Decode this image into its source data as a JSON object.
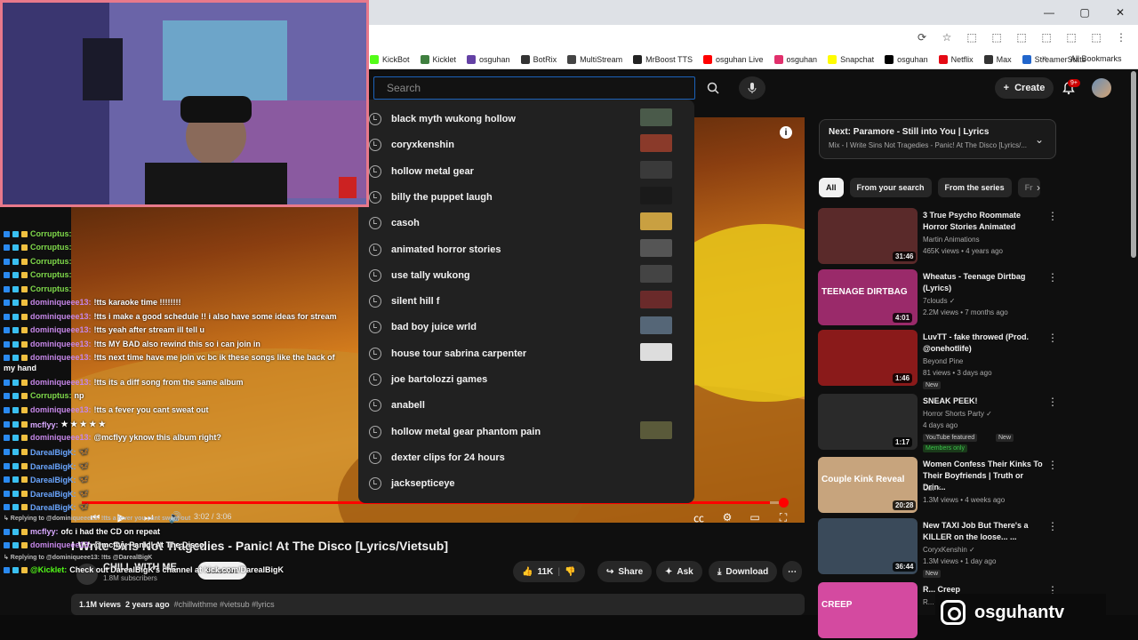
{
  "browser": {
    "controls": [
      "—",
      "▢",
      "✕"
    ],
    "addr_icons": [
      "⟳",
      "☆",
      "⬚",
      "⬚",
      "⬚",
      "⬚",
      "⬚",
      "⬚",
      "⋮"
    ]
  },
  "bookmarks": [
    {
      "label": "KickBot",
      "color": "#53fc18"
    },
    {
      "label": "Kicklet",
      "color": "#3f7f3f"
    },
    {
      "label": "osguhan",
      "color": "#6441a5"
    },
    {
      "label": "BotRix",
      "color": "#333333"
    },
    {
      "label": "MultiStream",
      "color": "#444444"
    },
    {
      "label": "MrBoost TTS",
      "color": "#222222"
    },
    {
      "label": "osguhan Live",
      "color": "#ff0000"
    },
    {
      "label": "osguhan",
      "color": "#e1306c"
    },
    {
      "label": "Snapchat",
      "color": "#fffc00"
    },
    {
      "label": "osguhan",
      "color": "#000000"
    },
    {
      "label": "Netflix",
      "color": "#e50914"
    },
    {
      "label": "Max",
      "color": "#333333"
    },
    {
      "label": "StreamerStats",
      "color": "#2266cc"
    }
  ],
  "bookmarks_more": "»",
  "all_bookmarks": "All Bookmarks",
  "search": {
    "placeholder": "Search"
  },
  "header": {
    "create_label": "Create",
    "notif_count": "9+"
  },
  "suggestions": [
    {
      "text": "black myth wukong hollow",
      "thumb": "#4a5a4a"
    },
    {
      "text": "coryxkenshin",
      "thumb": "#8a3a2a"
    },
    {
      "text": "hollow metal gear",
      "thumb": "#3a3a3a"
    },
    {
      "text": "billy the puppet laugh",
      "thumb": "#1a1a1a"
    },
    {
      "text": "casoh",
      "thumb": "#c9a041"
    },
    {
      "text": "animated horror stories",
      "thumb": "#555555"
    },
    {
      "text": "use tally wukong",
      "thumb": "#444444"
    },
    {
      "text": "silent hill f",
      "thumb": "#6a2a2a"
    },
    {
      "text": "bad boy juice wrld",
      "thumb": "#556677"
    },
    {
      "text": "house tour sabrina carpenter",
      "thumb": "#dddddd"
    },
    {
      "text": "joe bartolozzi games",
      "thumb": ""
    },
    {
      "text": "anabell",
      "thumb": ""
    },
    {
      "text": "hollow metal gear phantom pain",
      "thumb": "#5a5a3a"
    },
    {
      "text": "dexter clips for 24 hours",
      "thumb": ""
    },
    {
      "text": "jacksepticeye",
      "thumb": ""
    }
  ],
  "player": {
    "time": "3:02 / 3:06",
    "progress": 0.98
  },
  "video": {
    "title": "I Write Sins Not Tragedies - Panic! At The Disco [Lyrics/Vietsub]",
    "channel": "CHILL WITH ME",
    "subs": "1.8M subscribers",
    "subscribe": "Subscribe",
    "likes": "11K",
    "share": "Share",
    "ask": "Ask",
    "download": "Download",
    "views": "1.1M views",
    "age": "2 years ago",
    "tags": "#chillwithme #vietsub #lyrics"
  },
  "chat": [
    {
      "name": "Corruptus:",
      "color": "#7fd94a",
      "msg": ""
    },
    {
      "name": "Corruptus:",
      "color": "#7fd94a",
      "msg": ""
    },
    {
      "name": "Corruptus:",
      "color": "#7fd94a",
      "msg": ""
    },
    {
      "name": "Corruptus:",
      "color": "#7fd94a",
      "msg": ""
    },
    {
      "name": "Corruptus:",
      "color": "#7fd94a",
      "msg": ""
    },
    {
      "name": "dominiqueee13:",
      "color": "#c586e8",
      "msg": "!tts karaoke time !!!!!!!!"
    },
    {
      "name": "dominiqueee13:",
      "color": "#c586e8",
      "msg": "!tts i make a good schedule !! i also have some ideas for stream"
    },
    {
      "name": "dominiqueee13:",
      "color": "#c586e8",
      "msg": "!tts yeah after stream ill tell u"
    },
    {
      "name": "dominiqueee13:",
      "color": "#c586e8",
      "msg": "!tts MY BAD also rewind this so i can join in"
    },
    {
      "name": "dominiqueee13:",
      "color": "#c586e8",
      "msg": "!tts next time have me join vc bc ik these songs like the back of"
    },
    {
      "name": "dominiqueee13:",
      "color": "#c586e8",
      "msg": "!tts its a diff song from the same album"
    },
    {
      "name": "Corruptus:",
      "color": "#7fd94a",
      "msg": "np"
    },
    {
      "name": "dominiqueee13:",
      "color": "#c586e8",
      "msg": "!tts a fever you cant sweat out"
    },
    {
      "name": "mcflyy:",
      "color": "#d8a8ff",
      "msg": "★ ★ ★ ★ ★"
    },
    {
      "name": "dominiqueee13:",
      "color": "#c586e8",
      "msg": "@mcflyy yknow this album right?"
    },
    {
      "name": "DarealBigK:",
      "color": "#6aa6ff",
      "msg": "🦋"
    },
    {
      "name": "DarealBigK:",
      "color": "#6aa6ff",
      "msg": "🦋"
    },
    {
      "name": "DarealBigK:",
      "color": "#6aa6ff",
      "msg": "🦋"
    },
    {
      "name": "DarealBigK:",
      "color": "#6aa6ff",
      "msg": "🦋"
    },
    {
      "name": "DarealBigK:",
      "color": "#6aa6ff",
      "msg": "🦋"
    }
  ],
  "chat_wrap": "my hand",
  "chat_reply1": "↳ Replying to @dominiqueee13: !tts a fever you cant sweat out",
  "chat_line_a": {
    "name": "mcflyy:",
    "color": "#d8a8ff",
    "msg": "ofc i had the CD on repeat"
  },
  "chat_line_b": {
    "name": "dominiqueee13:",
    "color": "#c586e8",
    "msg": "@mcflyy Panic! At The Disco"
  },
  "chat_reply2": "↳ Replying to @dominiqueee13: !tts @DarealBigK",
  "chat_line_c": {
    "name": "@Kicklet:",
    "color": "#53fc18",
    "msg": "Check out DarealBigK's channel at kick.com/DarealBigK"
  },
  "upnext": {
    "title": "Next: Paramore - Still into You | Lyrics",
    "sub": "Mix - I Write Sins Not Tragedies - Panic! At The Disco [Lyrics/..."
  },
  "chips": [
    "All",
    "From your search",
    "From the series",
    "Fr"
  ],
  "recs": [
    {
      "title": "3 True Psycho Roommate Horror Stories Animated",
      "channel": "Martin Animations",
      "meta": "465K views • 4 years ago",
      "dur": "31:46",
      "badge": "",
      "badge2": "",
      "thumb": "#5a2a2a"
    },
    {
      "title": "Wheatus - Teenage Dirtbag (Lyrics)",
      "channel": "7clouds ✓",
      "meta": "2.2M views • 7 months ago",
      "dur": "4:01",
      "badge": "",
      "badge2": "",
      "thumb": "#9a2a6a",
      "overlay": "TEENAGE DIRTBAG"
    },
    {
      "title": "LuvTT - fake throwed (Prod. @onehotlife)",
      "channel": "Beyond Pine",
      "meta": "81 views • 3 days ago",
      "dur": "1:46",
      "badge": "New",
      "badge2": "",
      "thumb": "#8a1a1a"
    },
    {
      "title": "SNEAK PEEK!",
      "channel": "Horror Shorts Party ✓",
      "meta": "4 days ago",
      "dur": "1:17",
      "badge": "YouTube featured",
      "badge2": "New",
      "badge3": "Members only",
      "thumb": "#2a2a2a"
    },
    {
      "title": "Women Confess Their Kinks To Their Boyfriends | Truth or Drin...",
      "channel": "Cut ✓",
      "meta": "1.3M views • 4 weeks ago",
      "dur": "20:28",
      "badge": "",
      "badge2": "",
      "thumb": "#c7a47d",
      "overlay": "Couple Kink Reveal"
    },
    {
      "title": "New TAXI Job But There's a KILLER on the loose... ...",
      "channel": "CoryxKenshin ✓",
      "meta": "1.3M views • 1 day ago",
      "dur": "36:44",
      "badge": "New",
      "badge2": "",
      "thumb": "#3a4a5a"
    },
    {
      "title": "R... Creep",
      "channel": "R...",
      "meta": "",
      "dur": "",
      "badge": "",
      "badge2": "",
      "thumb": "#d44aa0",
      "overlay": "CREEP"
    }
  ],
  "instagram": "osguhantv"
}
